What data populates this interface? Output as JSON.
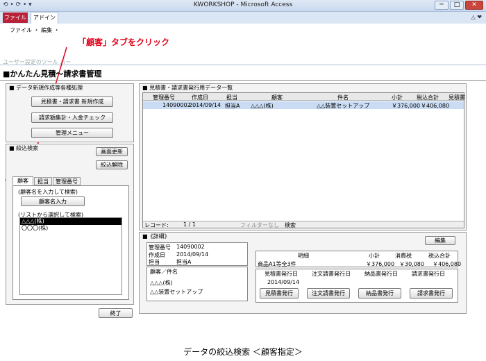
{
  "window": {
    "title": "KWORKSHOP - Microsoft Access",
    "qat": "⟲ • ⟳ • ▾",
    "controls": [
      "─",
      "□",
      "✕"
    ],
    "tab_controls": "△ ❤"
  },
  "ribbon": {
    "tabs": [
      "ファイル",
      "アドイン"
    ],
    "menu": "ファイル ・ 編集 ・",
    "group_label": "ユーザー設定のツール バー"
  },
  "annotation": {
    "callout": "「顧客」タブをクリック",
    "caption": "データの絞込検索 ＜顧客指定＞"
  },
  "form": {
    "title": "■かんたん見積～請求書管理"
  },
  "left_top": {
    "header": "■ データ新規作成等各種処理",
    "buttons": [
      "見積書・請求書 新規作成",
      "請求額集計・入金チェック",
      "管理メニュー"
    ]
  },
  "filter": {
    "header": "■ 絞込検索",
    "refresh": "画面更新",
    "clear": "絞込解除",
    "tabs": [
      "顧客",
      "担当",
      "管理番号"
    ],
    "hint1": "(顧客名を入力して検索)",
    "input_button": "顧客名入力",
    "hint2": "(リストから選択して検索)",
    "list": [
      "△△△(株)",
      "〇〇〇(株)"
    ]
  },
  "exit_button": "終了",
  "grid": {
    "header": "■ 見積書・請求書発行用データ一覧",
    "columns": [
      "管理番号",
      "作成日",
      "担当",
      "顧客",
      "件名",
      "小計",
      "税込合計",
      "見積書"
    ],
    "rows": [
      [
        "14090002",
        "2014/09/14",
        "担当A",
        "△△△(株)",
        "△△装置セットアップ",
        "￥376,000",
        "￥406,080",
        ""
      ]
    ],
    "nav": {
      "label": "レコード:",
      "pos": "1 / 1",
      "filter": "フィルターなし",
      "search": "検索"
    }
  },
  "detail": {
    "header": "■《詳細》",
    "edit": "編集",
    "fields": [
      {
        "label": "管理番号",
        "value": "14090002"
      },
      {
        "label": "作成日",
        "value": "2014/09/14"
      },
      {
        "label": "担当",
        "value": "担当A"
      }
    ],
    "client_label": "顧客／件名",
    "client": "△△△(株)",
    "subject": "△△装置セットアップ",
    "summary": {
      "h_detail": "明細",
      "h_sub": "小計",
      "h_tax": "消費税",
      "h_total": "税込合計",
      "item": "商品A1等全3件",
      "sub": "￥376,000",
      "tax": "￥30,080",
      "total": "￥406,080"
    },
    "issue": {
      "heads": [
        "見積書発行日",
        "注文請書発行日",
        "納品書発行日",
        "請求書発行日"
      ],
      "date": "2014/09/14",
      "buttons": [
        "見積書発行",
        "注文請書発行",
        "納品書発行",
        "請求書発行"
      ]
    }
  }
}
